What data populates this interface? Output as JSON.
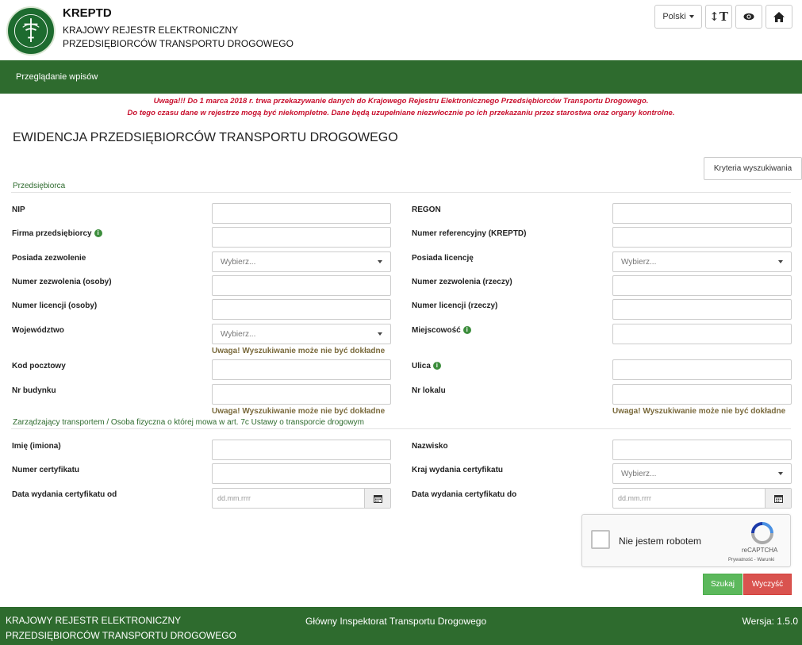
{
  "header": {
    "title": "KREPTD",
    "subtitle_line1": "KRAJOWY REJESTR ELEKTRONICZNY",
    "subtitle_line2": "PRZEDSIĘBIORCÓW TRANSPORTU DROGOWEGO",
    "logo_text_top": "INSPEKCJA",
    "logo_text_bottom": "TRANSPORTU DROGOWEGO",
    "language": "Polski",
    "font_size_icon": "text-size-icon",
    "contrast_icon": "eye-icon",
    "home_icon": "home-icon"
  },
  "nav": {
    "item": "Przeglądanie wpisów"
  },
  "notice": {
    "line1": "Uwaga!!! Do 1 marca 2018 r. trwa przekazywanie danych do Krajowego Rejestru Elektronicznego Przedsiębiorców Transportu Drogowego.",
    "line2": "Do tego czasu dane w rejestrze mogą być niekompletne. Dane będą uzupełniane niezwłocznie po ich przekazaniu przez starostwa oraz organy kontrolne."
  },
  "page_title": "EWIDENCJA PRZEDSIĘBIORCÓW TRANSPORTU DROGOWEGO",
  "criteria_button": "Kryteria wyszukiwania",
  "section1": {
    "title": "Przedsiębiorca",
    "nip": "NIP",
    "regon": "REGON",
    "firma": "Firma przedsiębiorcy",
    "numer_ref": "Numer referencyjny (KREPTD)",
    "posiada_zezwolenie": "Posiada zezwolenie",
    "posiada_licencje": "Posiada licencję",
    "select_placeholder": "Wybierz...",
    "nr_zezw_osoby": "Numer zezwolenia (osoby)",
    "nr_zezw_rzeczy": "Numer zezwolenia (rzeczy)",
    "nr_lic_osoby": "Numer licencji (osoby)",
    "nr_lic_rzeczy": "Numer licencji (rzeczy)",
    "wojewodztwo": "Województwo",
    "miejscowosc": "Miejscowość",
    "warning": "Uwaga! Wyszukiwanie może nie być dokładne",
    "kod_pocztowy": "Kod pocztowy",
    "ulica": "Ulica",
    "nr_budynku": "Nr budynku",
    "nr_lokalu": "Nr lokalu"
  },
  "section2": {
    "title": "Zarządzający transportem / Osoba fizyczna o której mowa w art. 7c Ustawy o transporcie drogowym",
    "imie": "Imię (imiona)",
    "nazwisko": "Nazwisko",
    "nr_cert": "Numer certyfikatu",
    "kraj": "Kraj wydania certyfikatu",
    "data_od": "Data wydania certyfikatu od",
    "data_do": "Data wydania certyfikatu do",
    "date_placeholder": "dd.mm.rrrr"
  },
  "captcha": {
    "label": "Nie jestem robotem",
    "brand": "reCAPTCHA",
    "links": "Prywatność - Warunki"
  },
  "buttons": {
    "search": "Szukaj",
    "clear": "Wyczyść"
  },
  "footer": {
    "left_line1": "KRAJOWY REJESTR ELEKTRONICZNY",
    "left_line2": "PRZEDSIĘBIORCÓW TRANSPORTU DROGOWEGO",
    "middle": "Główny Inspektorat Transportu Drogowego",
    "version": "Wersja: 1.5.0"
  },
  "colors": {
    "brand_green": "#2e6b2e",
    "notice_red": "#c8102e",
    "search_green": "#5cb85c",
    "clear_red": "#d9534f"
  }
}
